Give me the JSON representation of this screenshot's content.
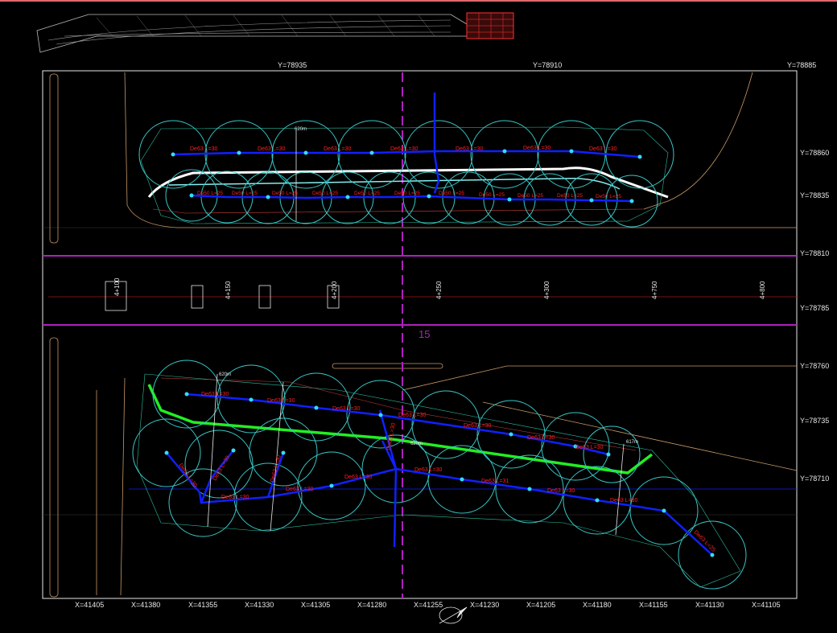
{
  "colors": {
    "background": "#000000",
    "frame": "#e8e8e8",
    "circle": "#37c7c7",
    "pipe": "#1020ff",
    "green_line": "#22ee22",
    "section_line": "#b020c0",
    "red_label": "#ff2020",
    "magenta_label": "#e020e0",
    "contour": "#c89868",
    "accent_bar": "#e0686e"
  },
  "top_y_labels": [
    "Y=78935",
    "Y=78910",
    "Y=78885"
  ],
  "right_y_labels": [
    "Y=78860",
    "Y=78835",
    "Y=78810",
    "Y=78785",
    "Y=78760",
    "Y=78735",
    "Y=78710"
  ],
  "bottom_x_labels": [
    "X=41405",
    "X=41380",
    "X=41355",
    "X=41330",
    "X=41305",
    "X=41280",
    "X=41255",
    "X=41230",
    "X=41205",
    "X=41180",
    "X=41155",
    "X=41130",
    "X=41105"
  ],
  "center_number": "15",
  "upper_pipe_labels": [
    "De63 L=30",
    "De63 L=30",
    "De63 L=30",
    "De63 L=30",
    "De63 L=30",
    "De63 L=30",
    "De63 L=30"
  ],
  "upper_lower_pipe_labels": [
    "De50 L=25",
    "De50 L=25",
    "De50 L=25",
    "De50 L=25",
    "De50 L=25",
    "De50 L=25",
    "De50 L=25",
    "De50 L=25",
    "De50 L=25",
    "De50 L=25",
    "De50 L=25",
    "De50 L=25",
    "De50 L=25"
  ],
  "lower_pipe_labels": [
    "De63 L=30",
    "De63 L=30",
    "De63 L=30",
    "De63 L=30",
    "De63 L=30",
    "De63 L=30",
    "De63 L=30"
  ],
  "lower_second_labels": [
    "De63 L=30",
    "De63 L=30",
    "De63 L=30",
    "De63 L=30",
    "De63 L=31",
    "De63 L=30",
    "De63 L=30"
  ],
  "side_labels": [
    "De63 L=30",
    "De63 L=30",
    "De63 L=30",
    "De63 L=30",
    "De63 L=25"
  ],
  "station_labels": [
    "4+100",
    "4+150",
    "4+200",
    "4+250",
    "4+300",
    "4+750",
    "4+800"
  ],
  "dim_labels": [
    "620m",
    "620m",
    "617m",
    "620m"
  ],
  "icons": [
    "north-arrow-icon"
  ]
}
